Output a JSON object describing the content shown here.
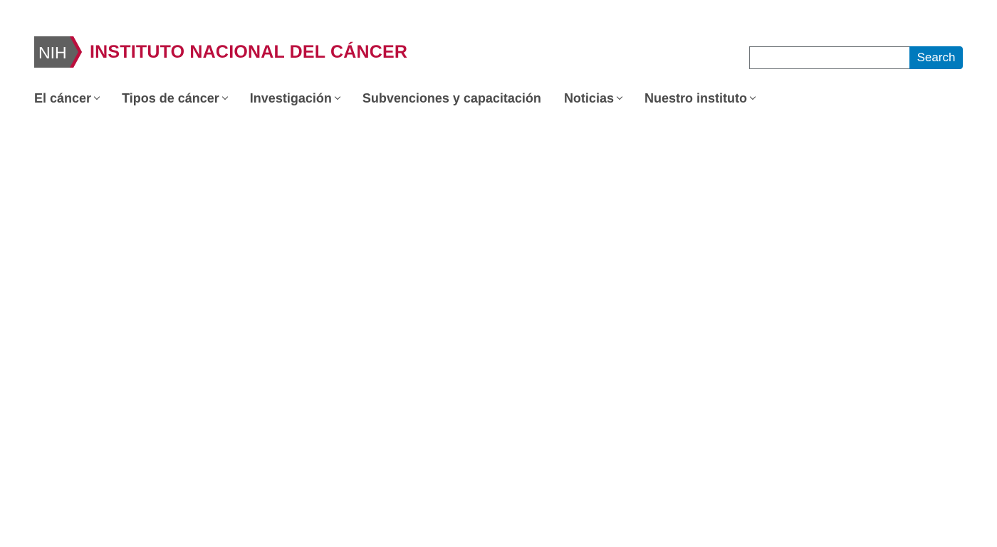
{
  "header": {
    "logo": {
      "badge_text": "NIH",
      "name": "INSTITUTO NACIONAL DEL CÁNCER"
    },
    "search": {
      "input_value": "",
      "button_label": "Search"
    }
  },
  "nav": {
    "items": [
      {
        "label": "El cáncer",
        "has_dropdown": true
      },
      {
        "label": "Tipos de cáncer",
        "has_dropdown": true
      },
      {
        "label": "Investigación",
        "has_dropdown": true
      },
      {
        "label": "Subvenciones y capacitación",
        "has_dropdown": false
      },
      {
        "label": "Noticias",
        "has_dropdown": true
      },
      {
        "label": "Nuestro instituto",
        "has_dropdown": true
      }
    ]
  },
  "colors": {
    "brand_red": "#bb0e3d",
    "badge_gray": "#606060",
    "search_button_blue": "#007abd",
    "nav_text": "#4a4a4a"
  },
  "icons": {
    "dropdown": "chevron-down-icon"
  }
}
